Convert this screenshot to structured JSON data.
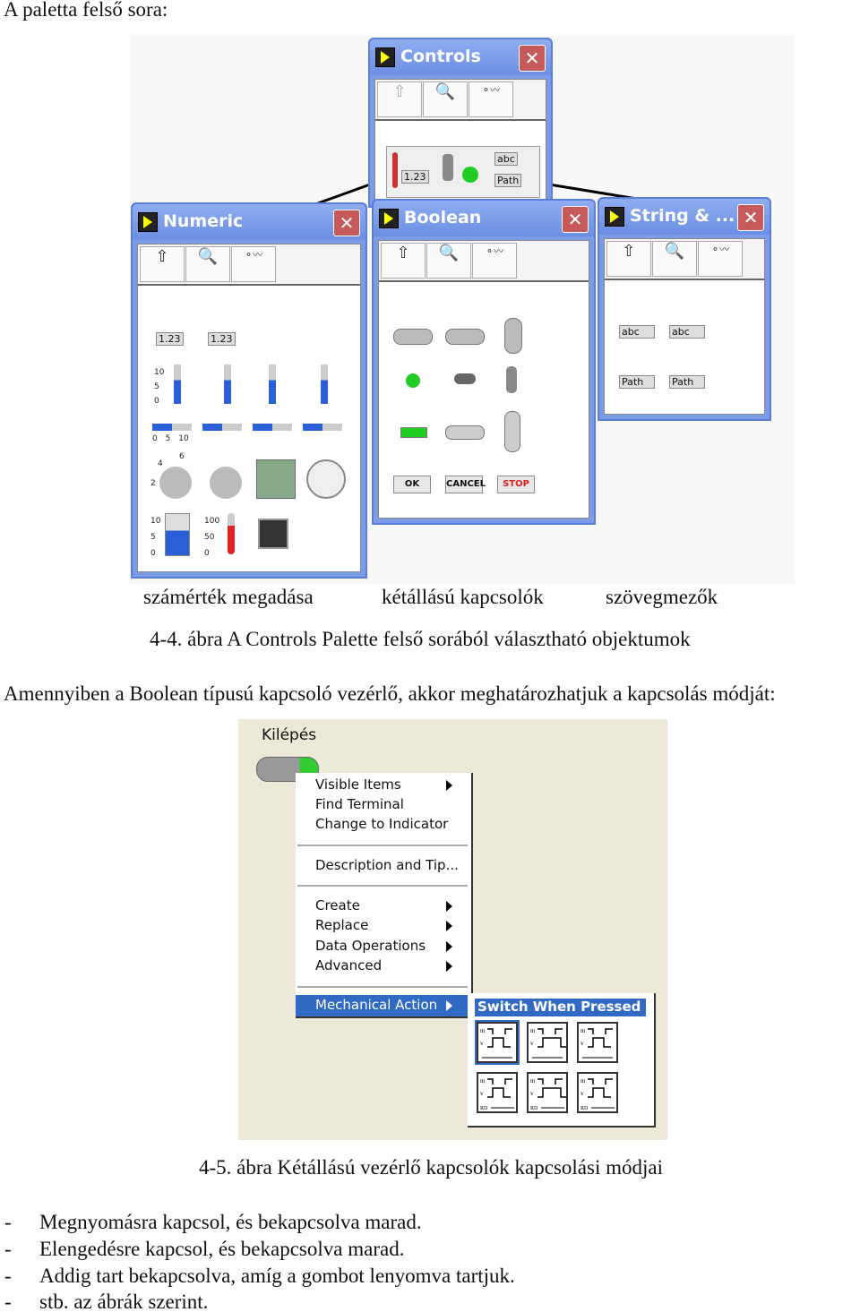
{
  "intro": "A paletta felső sora:",
  "figure1": {
    "controls": {
      "title": "Controls",
      "items": [
        "1.23",
        "abc",
        "Path"
      ]
    },
    "numeric": {
      "title": "Numeric",
      "digital": [
        "1.23",
        "1.23"
      ],
      "scale_v": [
        "10",
        "5",
        "0"
      ],
      "scale_h": [
        "0",
        "5",
        "10"
      ],
      "knob_marks": [
        "4",
        "6",
        "2"
      ],
      "tank_scale": [
        "10",
        "5",
        "0"
      ],
      "thermo_scale": [
        "100",
        "50",
        "0"
      ]
    },
    "boolean": {
      "title": "Boolean",
      "buttons": [
        "OK",
        "CANCEL",
        "STOP"
      ]
    },
    "string": {
      "title": "String & ...",
      "items": [
        "abc",
        "abc",
        "Path",
        "Path"
      ]
    },
    "captions": [
      "számérték megadása",
      "kétállású kapcsolók",
      "szövegmezők"
    ]
  },
  "caption1": "4-4. ábra A Controls Palette felső sorából választható objektumok",
  "paragraph": "Amennyiben a Boolean típusú kapcsoló vezérlő, akkor meghatározhatjuk a kapcsolás módját:",
  "figure2": {
    "control_label": "Kilépés",
    "menu": [
      "Visible Items",
      "Find Terminal",
      "Change to Indicator",
      "Description and Tip...",
      "Create",
      "Replace",
      "Data Operations",
      "Advanced",
      "Mechanical Action"
    ],
    "submenu_title": "Switch When Pressed",
    "mech_labels": {
      "m": "m",
      "v": "v",
      "rd": "RD"
    }
  },
  "caption2": "4-5. ábra Kétállású vezérlő kapcsolók kapcsolási módjai",
  "list": [
    "Megnyomásra kapcsol, és bekapcsolva marad.",
    "Elengedésre kapcsol, és bekapcsolva marad.",
    "Addig tart bekapcsolva, amíg a gombot lenyomva tartjuk.",
    "stb. az ábrák szerint."
  ],
  "colors": {
    "title_bar": "#6b8ee3",
    "menu_highlight": "#316ac5",
    "led_green": "#22cc22"
  }
}
